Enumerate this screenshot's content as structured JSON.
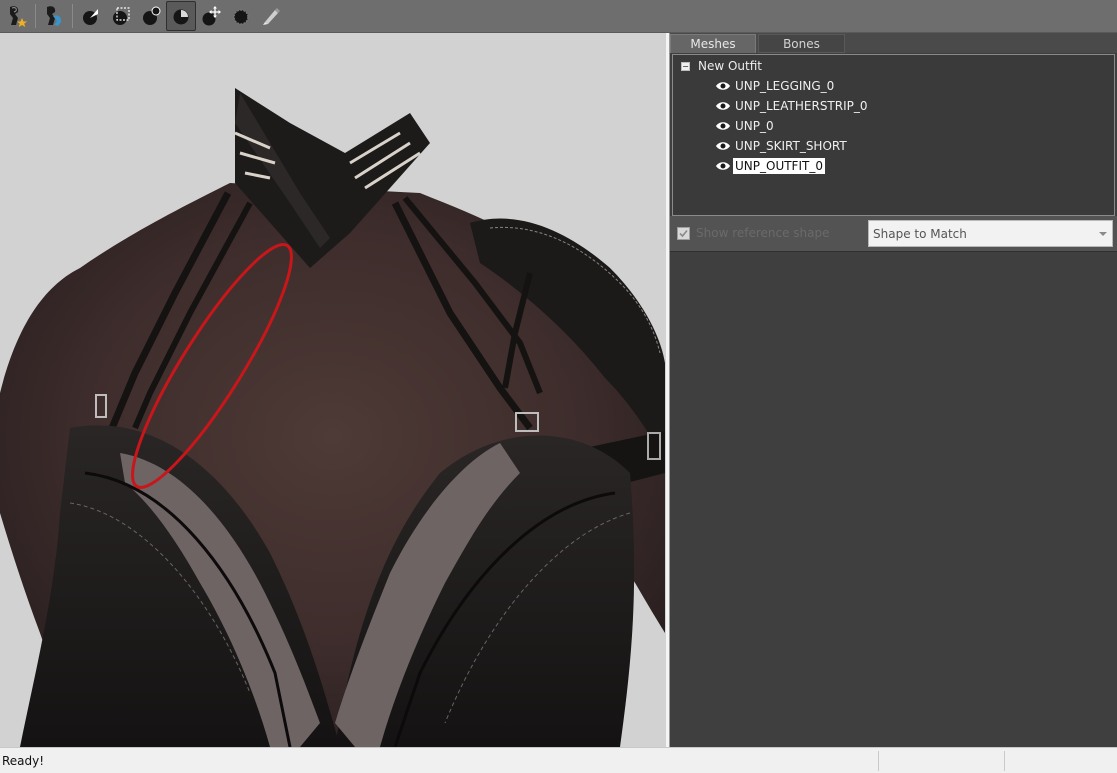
{
  "toolbar": {
    "tools": [
      {
        "icon": "load-reference-icon",
        "active": false
      },
      {
        "icon": "load-outfit-icon",
        "active": false
      },
      {
        "icon": "select-tool-icon",
        "active": false
      },
      {
        "icon": "mask-brush-icon",
        "active": false
      },
      {
        "icon": "inflate-brush-icon",
        "active": false
      },
      {
        "icon": "deflate-brush-icon",
        "active": true
      },
      {
        "icon": "move-brush-icon",
        "active": false
      },
      {
        "icon": "smooth-brush-icon",
        "active": false
      },
      {
        "icon": "weight-brush-icon",
        "active": false
      }
    ]
  },
  "right_panel": {
    "tabs": [
      {
        "label": "Meshes",
        "active": true
      },
      {
        "label": "Bones",
        "active": false
      }
    ],
    "tree": {
      "root": "New Outfit",
      "meshes": [
        {
          "name": "UNP_LEGGING_0",
          "visible": true,
          "selected": false
        },
        {
          "name": "UNP_LEATHERSTRIP_0",
          "visible": true,
          "selected": false
        },
        {
          "name": "UNP_0",
          "visible": true,
          "selected": false
        },
        {
          "name": "UNP_SKIRT_SHORT",
          "visible": true,
          "selected": false
        },
        {
          "name": "UNP_OUTFIT_0",
          "visible": true,
          "selected": true
        }
      ]
    },
    "options": {
      "checkbox_label": "Show reference shape",
      "checkbox_checked": true,
      "shape_select_value": "Shape to Match"
    }
  },
  "status": {
    "text": "Ready!"
  },
  "colors": {
    "toolbar_bg": "#6e6e6e",
    "panel_bg": "#3f3f3f",
    "viewport_bg": "#d2d2d2",
    "annotation_red": "#c8161a"
  }
}
